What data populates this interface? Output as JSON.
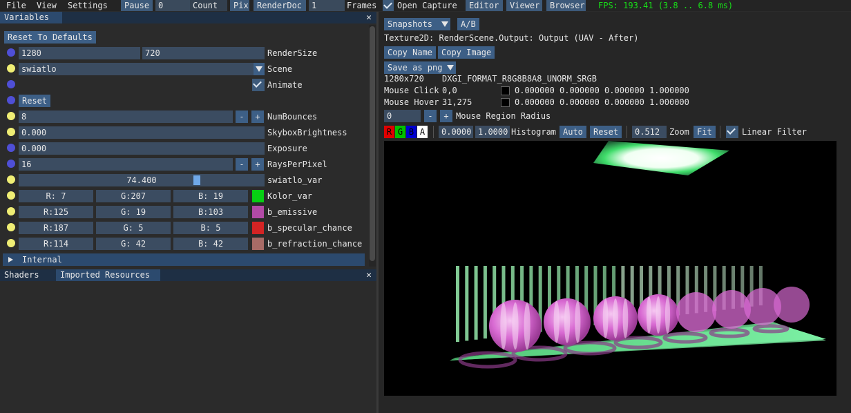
{
  "menubar": {
    "file": "File",
    "view": "View",
    "settings": "Settings",
    "pause": "Pause",
    "frame_value": "0",
    "count": "Count",
    "pix": "Pix",
    "renderdoc": "RenderDoc",
    "frames_value": "1",
    "frames": "Frames",
    "open_capture": "Open Capture",
    "editor": "Editor",
    "viewer": "Viewer",
    "browser": "Browser",
    "fps": "FPS: 193.41 (3.8 .. 6.8 ms)"
  },
  "variables_panel": {
    "tab": "Variables",
    "close": "✕",
    "reset_defaults": "Reset To Defaults",
    "render_size": {
      "w": "1280",
      "h": "720",
      "label": "RenderSize"
    },
    "scene": {
      "value": "swiatlo",
      "label": "Scene"
    },
    "animate": {
      "label": "Animate"
    },
    "reset": "Reset",
    "num_bounces": {
      "value": "8",
      "label": "NumBounces"
    },
    "skybox": {
      "value": "0.000",
      "label": "SkyboxBrightness"
    },
    "exposure": {
      "value": "0.000",
      "label": "Exposure"
    },
    "rays": {
      "value": "16",
      "label": "RaysPerPixel"
    },
    "swiatlo_var": {
      "value": "74.400",
      "label": "swiatlo_var",
      "fraction": 0.73
    },
    "minus": "-",
    "plus": "+",
    "colors": [
      {
        "r": "R:  7",
        "g": "G:207",
        "b": "B: 19",
        "label": "Kolor_var",
        "swatch": "#07cf13"
      },
      {
        "r": "R:125",
        "g": "G: 19",
        "b": "B:103",
        "label": "b_emissive",
        "swatch": "#b24aa6"
      },
      {
        "r": "R:187",
        "g": "G:  5",
        "b": "B:  5",
        "label": "b_specular_chance",
        "swatch": "#d42424"
      },
      {
        "r": "R:114",
        "g": "G: 42",
        "b": "B: 42",
        "label": "b_refraction_chance",
        "swatch": "#a86b66"
      }
    ],
    "internal": "Internal"
  },
  "bottom_panel": {
    "tab_shaders": "Shaders",
    "tab_imported": "Imported Resources",
    "close": "✕"
  },
  "viewer": {
    "snapshots": "Snapshots",
    "ab": "A/B",
    "texture": "Texture2D: RenderScene.Output: Output (UAV - After)",
    "copy_name": "Copy Name",
    "copy_image": "Copy Image",
    "save_as": "Save as png",
    "size": "1280x720",
    "format": "DXGI_FORMAT_R8G8B8A8_UNORM_SRGB",
    "mouse_click_label": "Mouse Click",
    "mouse_click_pos": "0,0",
    "mouse_click_val": "0.000000 0.000000 0.000000 1.000000",
    "mouse_hover_label": "Mouse Hover",
    "mouse_hover_pos": "31,275",
    "mouse_hover_val": "0.000000 0.000000 0.000000 1.000000",
    "radius_value": "0",
    "radius_label": "Mouse Region Radius",
    "channels": [
      "R",
      "G",
      "B",
      "A"
    ],
    "hist_min": "0.0000",
    "hist_max": "1.0000",
    "histogram": "Histogram",
    "auto": "Auto",
    "reset": "Reset",
    "zoom_value": "0.512",
    "zoom": "Zoom",
    "fit": "Fit",
    "linear_filter": "Linear Filter",
    "minus": "-",
    "plus": "+"
  },
  "colors": {
    "accent": "#3d5f86",
    "fps": "#18e018",
    "panel_bg": "#2b2b2b",
    "tab_active": "#2c4a6e"
  }
}
